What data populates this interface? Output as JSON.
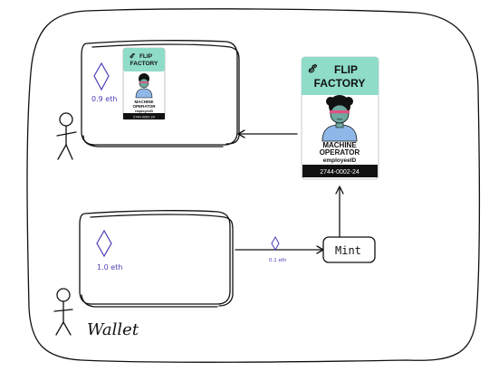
{
  "colors": {
    "badge_header": "#8fdcc8",
    "badge_footer": "#111111",
    "eth_purple": "#4a3fb8",
    "ink": "#111111"
  },
  "owned_wallet": {
    "eth_amount": "0.9 eth",
    "icon": "ethereum-diamond-icon"
  },
  "new_wallet": {
    "eth_amount": "1.0 eth",
    "icon": "ethereum-diamond-icon",
    "label": "Wallet"
  },
  "transfer": {
    "eth_amount": "0.1 eth",
    "icon": "ethereum-diamond-icon"
  },
  "mint": {
    "label": "Mint"
  },
  "badge": {
    "brand_line1": "FLIP",
    "brand_line2": "FACTORY",
    "role_line1": "MACHINE",
    "role_line2": "OPERATOR",
    "field": "employeeID",
    "id_number": "2744-0002-24"
  },
  "badge_small": {
    "brand_line1": "FLIP",
    "brand_line2": "FACTORY",
    "role_line1": "MACHINE",
    "role_line2": "OPERATOR",
    "field": "employeeID",
    "id_number": "2744-0002-24"
  }
}
